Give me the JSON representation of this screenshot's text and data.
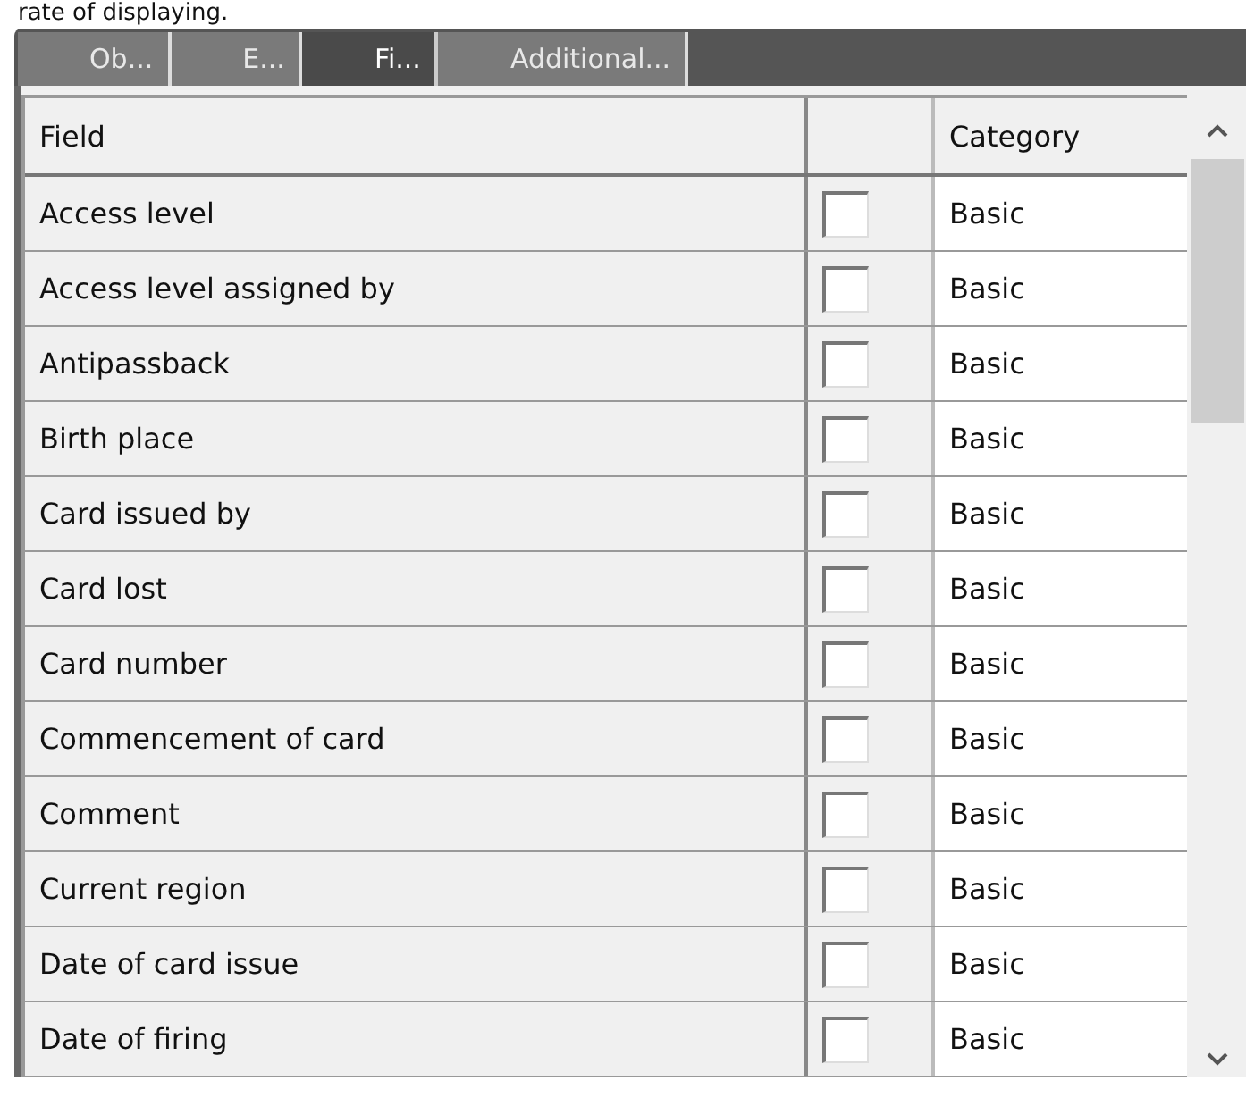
{
  "caption": "rate of displaying.",
  "tabs": [
    {
      "label": "Ob...",
      "selected": false
    },
    {
      "label": "E...",
      "selected": false
    },
    {
      "label": "Fi...",
      "selected": true
    },
    {
      "label": "Additional...",
      "selected": false
    }
  ],
  "table": {
    "columns": [
      "Field",
      "",
      "Category"
    ],
    "rows": [
      {
        "field": "Access level",
        "checked": false,
        "category": "Basic"
      },
      {
        "field": "Access level assigned by",
        "checked": false,
        "category": "Basic"
      },
      {
        "field": "Antipassback",
        "checked": false,
        "category": "Basic"
      },
      {
        "field": "Birth place",
        "checked": false,
        "category": "Basic"
      },
      {
        "field": "Card issued by",
        "checked": false,
        "category": "Basic"
      },
      {
        "field": "Card lost",
        "checked": false,
        "category": "Basic"
      },
      {
        "field": "Card number",
        "checked": false,
        "category": "Basic"
      },
      {
        "field": "Commencement of card",
        "checked": false,
        "category": "Basic"
      },
      {
        "field": "Comment",
        "checked": false,
        "category": "Basic"
      },
      {
        "field": "Current region",
        "checked": false,
        "category": "Basic"
      },
      {
        "field": "Date of card issue",
        "checked": false,
        "category": "Basic"
      },
      {
        "field": "Date of firing",
        "checked": false,
        "category": "Basic"
      }
    ]
  }
}
